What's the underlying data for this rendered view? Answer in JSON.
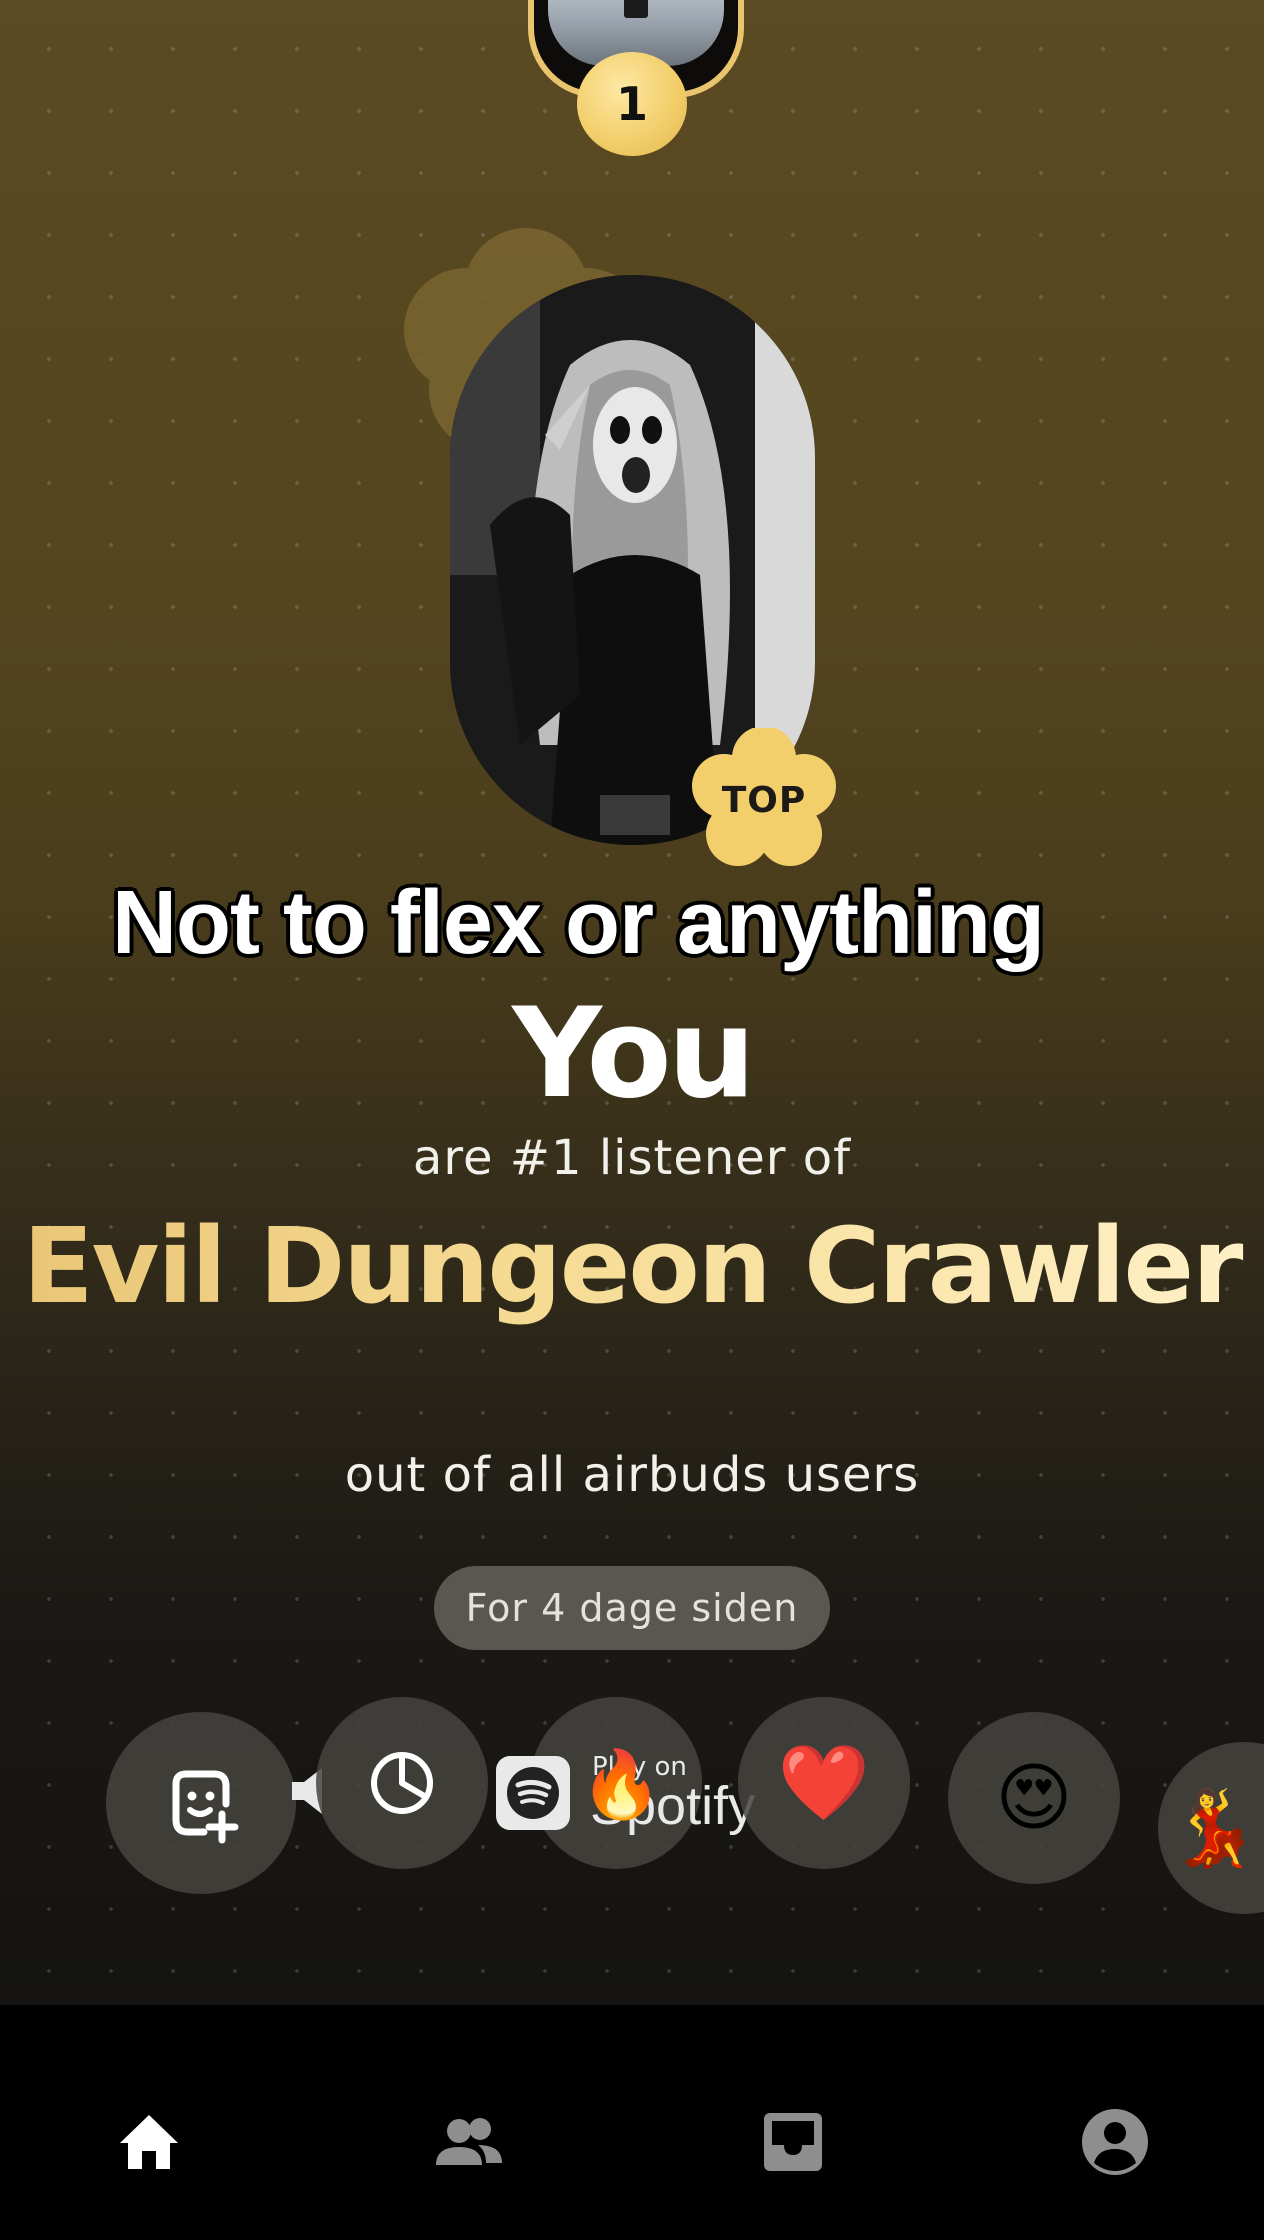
{
  "top_rank": {
    "number": "1"
  },
  "artist_badge": {
    "label": "TOP"
  },
  "caption": "Not to flex or anything",
  "headline": {
    "you": "You",
    "line1": "are #1 listener of",
    "artist": "Evil Dungeon Crawler",
    "line2": "out of all airbuds users"
  },
  "time_pill": "For 4 dage siden",
  "reactions": {
    "spotify_play_on": "Play on",
    "spotify_word": "Spotify",
    "items": [
      {
        "name": "add-sticker-icon"
      },
      {
        "name": "timer-icon"
      },
      {
        "name": "spotify-icon"
      },
      {
        "name": "heart-emoji",
        "glyph": "❤️"
      },
      {
        "name": "heart-eyes-emoji",
        "glyph": "😍"
      },
      {
        "name": "dancer-emoji",
        "glyph": "💃"
      }
    ],
    "fire_glyph": "🔥"
  },
  "colors": {
    "accent_gold": "#e9c66d",
    "pill_bg": "#5a5751",
    "nav_active": "#ffffff",
    "nav_inactive": "#8e8e8e"
  },
  "nav": [
    {
      "name": "home-icon",
      "active": true
    },
    {
      "name": "friends-icon",
      "active": false
    },
    {
      "name": "inbox-icon",
      "active": false
    },
    {
      "name": "profile-icon",
      "active": false
    }
  ]
}
